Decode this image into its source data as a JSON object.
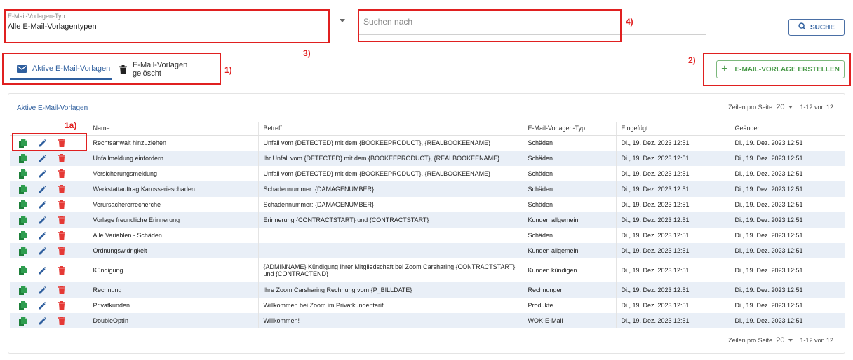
{
  "filter": {
    "type_label": "E-Mail-Vorlagen-Typ",
    "type_value": "Alle E-Mail-Vorlagentypen",
    "search_placeholder": "Suchen nach",
    "search_button": "SUCHE"
  },
  "tabs": {
    "active_label": "Aktive E-Mail-Vorlagen",
    "deleted_label": "E-Mail-Vorlagen gelöscht"
  },
  "create_button": "E-MAIL-VORLAGE ERSTELLEN",
  "annotations": {
    "a1": "1)",
    "a1a": "1a)",
    "a2": "2)",
    "a3": "3)",
    "a4": "4)"
  },
  "card": {
    "title": "Aktive E-Mail-Vorlagen",
    "rows_per_page_label": "Zeilen pro Seite",
    "rows_per_page_value": "20",
    "range": "1-12 von 12"
  },
  "table": {
    "headers": [
      "",
      "Name",
      "Betreff",
      "E-Mail-Vorlagen-Typ",
      "Eingefügt",
      "Geändert"
    ],
    "rows": [
      {
        "name": "Rechtsanwalt hinzuziehen",
        "subject": "Unfall vom {DETECTED} mit dem {BOOKEEPRODUCT}, {REALBOOKEENAME}",
        "type": "Schäden",
        "inserted": "Di., 19. Dez. 2023 12:51",
        "changed": "Di., 19. Dez. 2023 12:51"
      },
      {
        "name": "Unfallmeldung einfordern",
        "subject": "Ihr Unfall vom {DETECTED} mit dem {BOOKEEPRODUCT}, {REALBOOKEENAME}",
        "type": "Schäden",
        "inserted": "Di., 19. Dez. 2023 12:51",
        "changed": "Di., 19. Dez. 2023 12:51"
      },
      {
        "name": "Versicherungsmeldung",
        "subject": "Unfall vom {DETECTED} mit dem {BOOKEEPRODUCT}, {REALBOOKEENAME}",
        "type": "Schäden",
        "inserted": "Di., 19. Dez. 2023 12:51",
        "changed": "Di., 19. Dez. 2023 12:51"
      },
      {
        "name": "Werkstattauftrag Karosserieschaden",
        "subject": "Schadennummer: {DAMAGENUMBER}",
        "type": "Schäden",
        "inserted": "Di., 19. Dez. 2023 12:51",
        "changed": "Di., 19. Dez. 2023 12:51"
      },
      {
        "name": "Verursachererrecherche",
        "subject": "Schadennummer: {DAMAGENUMBER}",
        "type": "Schäden",
        "inserted": "Di., 19. Dez. 2023 12:51",
        "changed": "Di., 19. Dez. 2023 12:51"
      },
      {
        "name": "Vorlage freundliche Erinnerung",
        "subject": "Erinnerung {CONTRACTSTART} und {CONTRACTSTART}",
        "type": "Kunden allgemein",
        "inserted": "Di., 19. Dez. 2023 12:51",
        "changed": "Di., 19. Dez. 2023 12:51"
      },
      {
        "name": "Alle Variablen - Schäden",
        "subject": "",
        "type": "Schäden",
        "inserted": "Di., 19. Dez. 2023 12:51",
        "changed": "Di., 19. Dez. 2023 12:51"
      },
      {
        "name": "Ordnungswidrigkeit",
        "subject": "",
        "type": "Kunden allgemein",
        "inserted": "Di., 19. Dez. 2023 12:51",
        "changed": "Di., 19. Dez. 2023 12:51"
      },
      {
        "name": "Kündigung",
        "subject": "{ADMINNAME} Kündigung Ihrer Mitgliedschaft bei Zoom Carsharing {CONTRACTSTART} und {CONTRACTEND}",
        "type": "Kunden kündigen",
        "inserted": "Di., 19. Dez. 2023 12:51",
        "changed": "Di., 19. Dez. 2023 12:51"
      },
      {
        "name": "Rechnung",
        "subject": "Ihre Zoom Carsharing Rechnung vom {P_BILLDATE}",
        "type": "Rechnungen",
        "inserted": "Di., 19. Dez. 2023 12:51",
        "changed": "Di., 19. Dez. 2023 12:51"
      },
      {
        "name": "Privatkunden",
        "subject": "Willkommen bei Zoom im Privatkundentarif",
        "type": "Produkte",
        "inserted": "Di., 19. Dez. 2023 12:51",
        "changed": "Di., 19. Dez. 2023 12:51"
      },
      {
        "name": "DoubleOptIn",
        "subject": "Willkommen!",
        "type": "WOK-E-Mail",
        "inserted": "Di., 19. Dez. 2023 12:51",
        "changed": "Di., 19. Dez. 2023 12:51"
      }
    ]
  },
  "icons": {
    "copy": "copy-icon",
    "edit": "pencil-icon",
    "delete": "trash-icon",
    "search": "search-icon",
    "mail": "mail-icon",
    "add": "plus-icon"
  },
  "colors": {
    "primary": "#2f5f9e",
    "copy_icon": "#2e9d4f",
    "edit_icon": "#2f5f9e",
    "delete_icon": "#e53935",
    "create_button": "#4a9a4a",
    "annotation": "#e02020",
    "row_alt": "#e9eff7"
  }
}
